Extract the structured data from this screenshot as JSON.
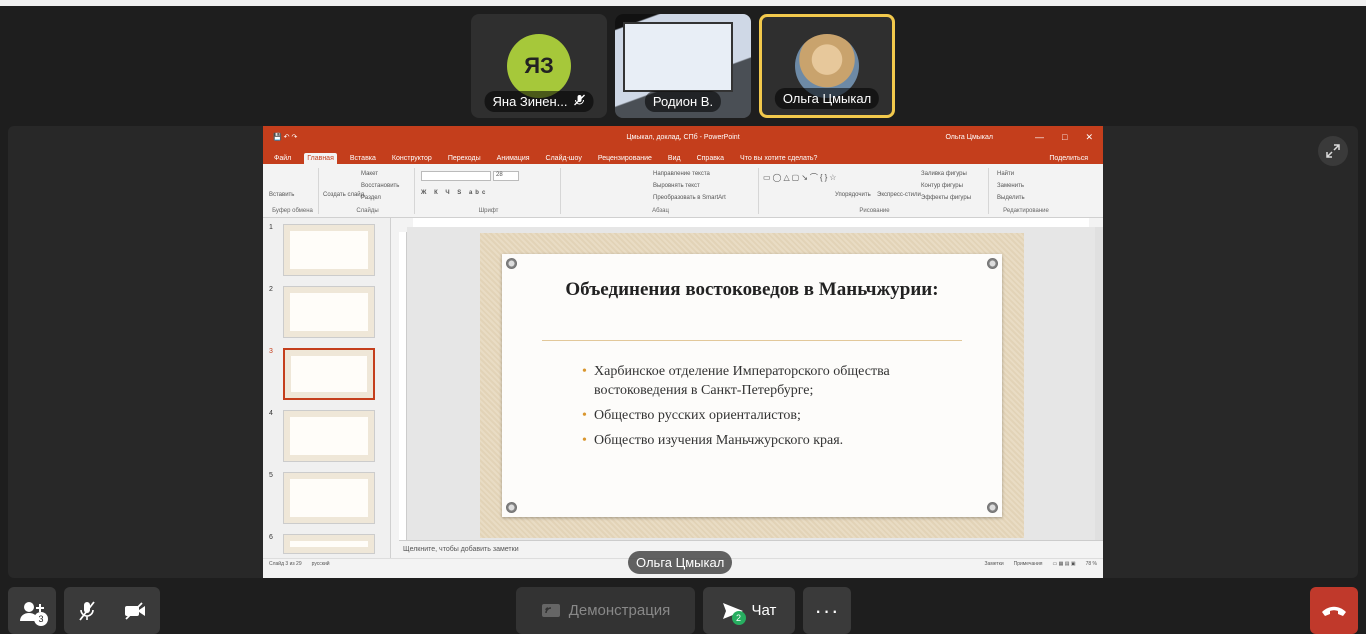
{
  "participants": [
    {
      "name": "Яна Зинен...",
      "initials": "ЯЗ",
      "muted": true
    },
    {
      "name": "Родион В.",
      "video": true
    },
    {
      "name": "Ольга Цмыкал",
      "speaking": true
    }
  ],
  "stage": {
    "speaker_label": "Ольга Цмыкал",
    "app": {
      "window_title": "Цмыкал, доклад, СПб - PowerPoint",
      "user": "Ольга Цмыкал",
      "tabs": [
        "Файл",
        "Главная",
        "Вставка",
        "Конструктор",
        "Переходы",
        "Анимация",
        "Слайд-шоу",
        "Рецензирование",
        "Вид",
        "Справка",
        "Что вы хотите сделать?"
      ],
      "share_label": "Поделиться",
      "ribbon": {
        "clipboard_label": "Буфер обмена",
        "paste_label": "Вставить",
        "slides_label": "Слайды",
        "new_slide_label": "Создать слайд",
        "layout_label": "Макет",
        "reset_label": "Восстановить",
        "section_label": "Раздел",
        "font_label": "Шрифт",
        "font_size": "28",
        "paragraph_label": "Абзац",
        "text_direction": "Направление текста",
        "align_text": "Выровнять текст",
        "smartart": "Преобразовать в SmartArt",
        "drawing_label": "Рисование",
        "arrange_label": "Упорядочить",
        "quick_styles": "Экспресс-стили",
        "fill": "Заливка фигуры",
        "outline": "Контур фигуры",
        "effects": "Эффекты фигуры",
        "editing_label": "Редактирование",
        "find": "Найти",
        "replace": "Заменить",
        "select": "Выделить"
      },
      "slide_numbers": [
        "1",
        "2",
        "3",
        "4",
        "5",
        "6"
      ],
      "selected_slide": 3,
      "slide": {
        "title": "Объединения востоковедов в Маньчжурии:",
        "bullets": [
          "Харбинское отделение Императорского общества востоковедения в Санкт-Петербурге;",
          "Общество русских ориенталистов;",
          "Общество изучения Маньчжурского края."
        ]
      },
      "notes_placeholder": "Щелкните, чтобы добавить заметки",
      "status": {
        "slide_info": "Слайд 3 из 29",
        "language": "русский",
        "notes": "Заметки",
        "comments": "Примечания",
        "zoom": "78 %"
      }
    }
  },
  "toolbar": {
    "add_count": "3",
    "demo_label": "Демонстрация",
    "chat_label": "Чат",
    "chat_count": "2",
    "more_label": "···"
  },
  "colors": {
    "accent": "#f2c94c",
    "ppt": "#c43e1c",
    "end_call": "#c0392b",
    "avatar": "#a6c83a"
  }
}
